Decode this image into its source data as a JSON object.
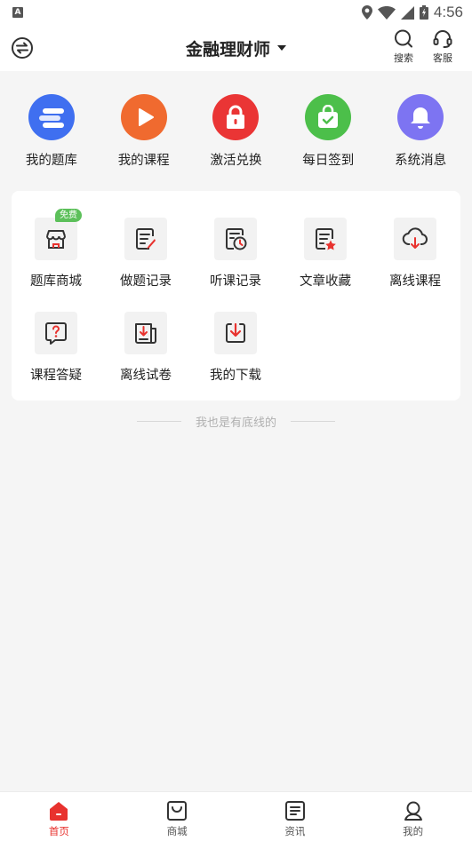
{
  "status_bar": {
    "left_icon": "A",
    "time": "4:56"
  },
  "header": {
    "title": "金融理财师",
    "search_label": "搜索",
    "service_label": "客服"
  },
  "quick_actions": [
    {
      "label": "我的题库",
      "icon": "question-bank-icon",
      "color": "#3f6ff0"
    },
    {
      "label": "我的课程",
      "icon": "play-icon",
      "color": "#f06a2f"
    },
    {
      "label": "激活兑换",
      "icon": "lock-icon",
      "color": "#ea3535"
    },
    {
      "label": "每日签到",
      "icon": "checkin-bag-icon",
      "color": "#4cbf4a"
    },
    {
      "label": "系统消息",
      "icon": "bell-icon",
      "color": "#7d74f2"
    }
  ],
  "tools": [
    {
      "label": "题库商城",
      "icon": "store-icon",
      "badge": "免费"
    },
    {
      "label": "做题记录",
      "icon": "edit-record-icon"
    },
    {
      "label": "听课记录",
      "icon": "clock-record-icon"
    },
    {
      "label": "文章收藏",
      "icon": "star-document-icon"
    },
    {
      "label": "离线课程",
      "icon": "cloud-download-icon"
    },
    {
      "label": "课程答疑",
      "icon": "question-icon"
    },
    {
      "label": "离线试卷",
      "icon": "paper-download-icon"
    },
    {
      "label": "我的下载",
      "icon": "download-icon"
    }
  ],
  "footer_note": "我也是有底线的",
  "tabs": [
    {
      "label": "首页",
      "icon": "home-icon",
      "active": true
    },
    {
      "label": "商城",
      "icon": "shopping-bag-icon",
      "active": false
    },
    {
      "label": "资讯",
      "icon": "news-icon",
      "active": false
    },
    {
      "label": "我的",
      "icon": "profile-icon",
      "active": false
    }
  ],
  "colors": {
    "accent": "#e8322e",
    "badge": "#5cc05a"
  }
}
